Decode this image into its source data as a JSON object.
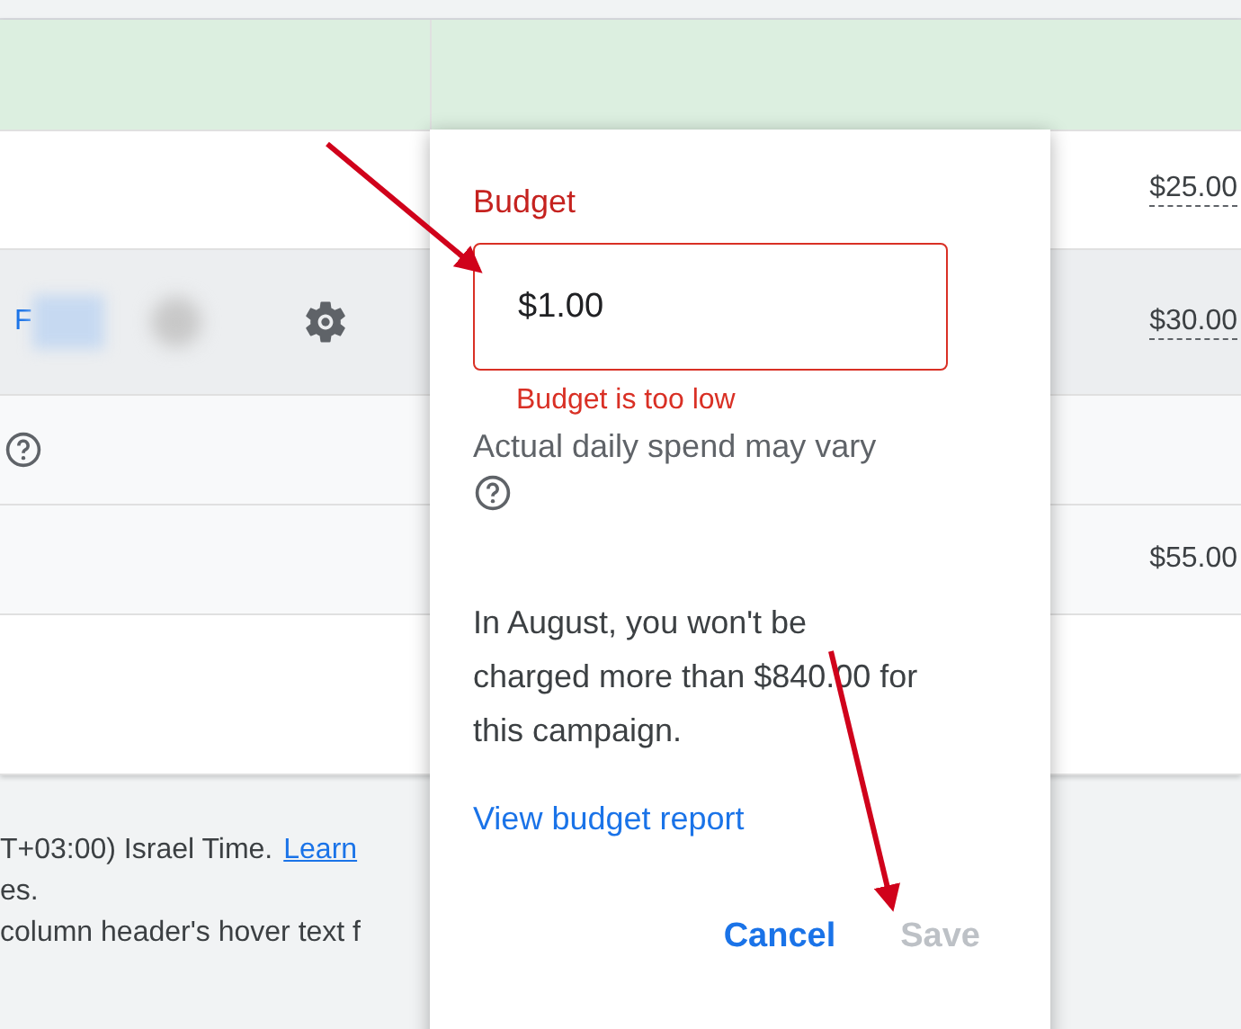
{
  "table": {
    "rows": [
      {
        "selected": true
      },
      {
        "selected": false,
        "hovered": false,
        "budget": "$25.00",
        "budget_editable": true
      },
      {
        "selected": false,
        "hovered": true,
        "name": "F",
        "settings": true,
        "budget": "$30.00",
        "budget_editable": true
      },
      {
        "selected": false,
        "hovered": false,
        "help": true
      },
      {
        "selected": false,
        "hovered": false,
        "budget": "$55.00",
        "budget_editable": false
      },
      {
        "selected": false,
        "hovered": false
      }
    ]
  },
  "footer": {
    "lines": [
      {
        "text": "T+03:00) Israel Time.",
        "link": "Learn"
      },
      {
        "text": "es."
      },
      {
        "text": "column header's hover text f"
      }
    ]
  },
  "budget_popup": {
    "label": "Budget",
    "value": "$1.00",
    "error": "Budget is too low",
    "helper": "Actual daily spend may vary",
    "info": "In August, you won't be charged more than $840.00 for this campaign.",
    "report_link": "View budget report",
    "buttons": [
      {
        "label": "Cancel",
        "disabled": false
      },
      {
        "label": "Save",
        "disabled": true
      }
    ]
  }
}
